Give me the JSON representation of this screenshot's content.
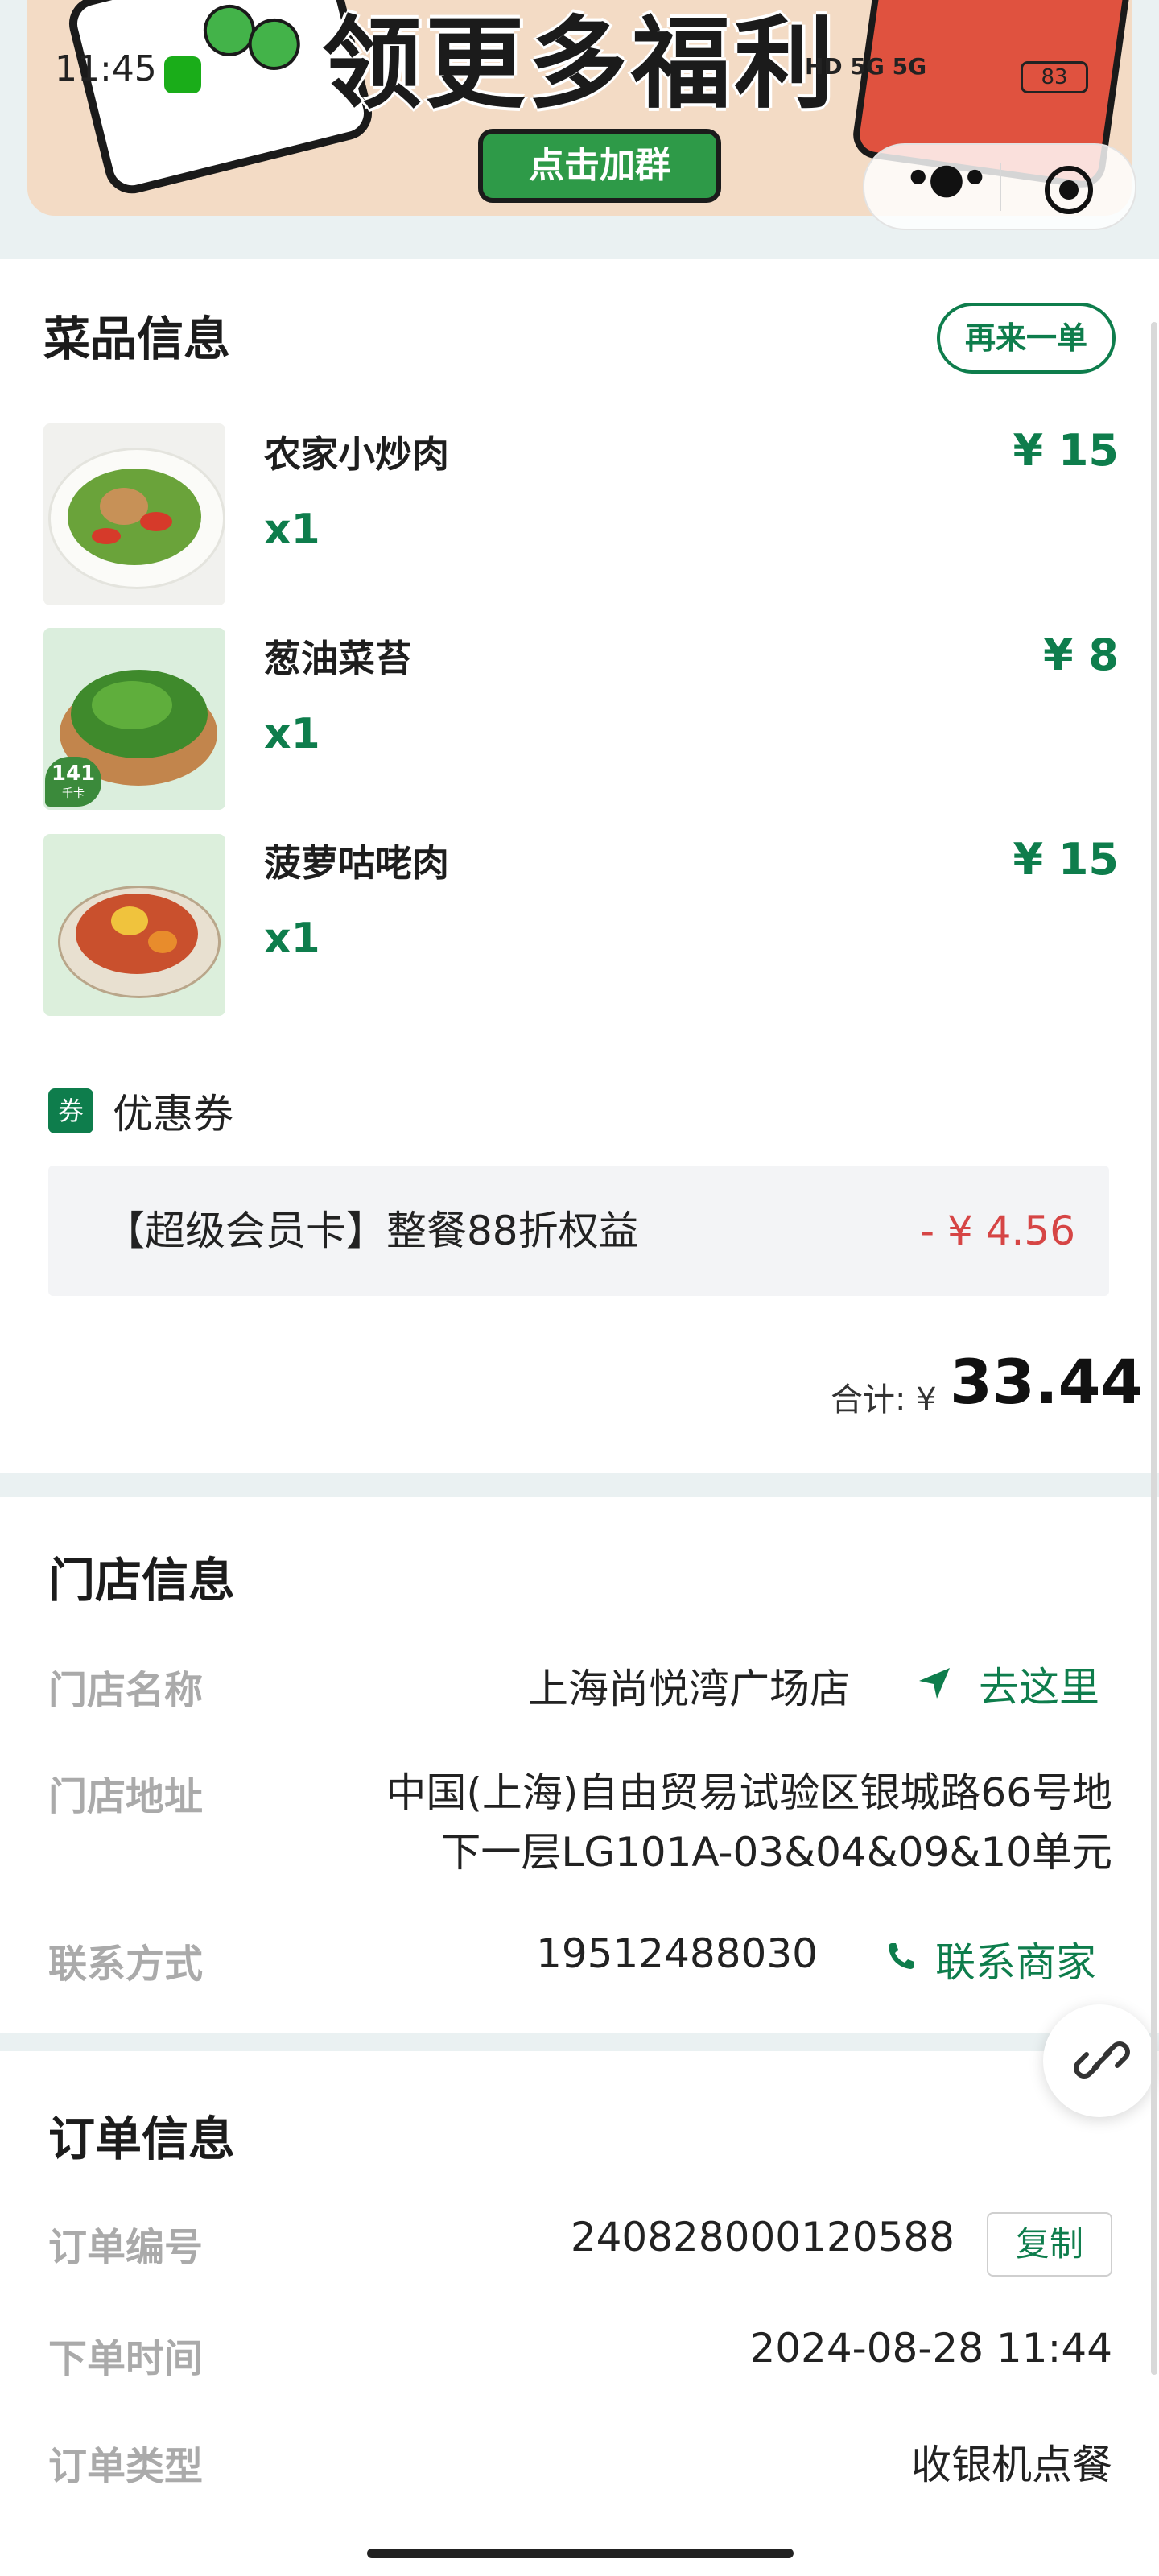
{
  "status_bar": {
    "time": "11:45",
    "network": "HD 5G 5G",
    "battery": "83"
  },
  "banner": {
    "headline": "领更多福利",
    "button": "点击加群"
  },
  "capsule": {
    "more_icon": "more-dots-icon",
    "close_icon": "target-close-icon"
  },
  "dishes_section": {
    "title": "菜品信息",
    "reorder_label": "再来一单",
    "items": [
      {
        "name": "农家小炒肉",
        "qty": "x1",
        "price": "¥ 15"
      },
      {
        "name": "葱油菜苔",
        "qty": "x1",
        "price": "¥ 8",
        "calorie_value": "141",
        "calorie_unit": "千卡"
      },
      {
        "name": "菠萝咕咾肉",
        "qty": "x1",
        "price": "¥ 15"
      }
    ],
    "coupon": {
      "badge": "券",
      "title": "优惠券",
      "name": "【超级会员卡】整餐88折权益",
      "amount": "- ¥ 4.56"
    },
    "total": {
      "label": "合计: ¥",
      "value": "33.44"
    }
  },
  "store_section": {
    "title": "门店信息",
    "name_label": "门店名称",
    "name_value": "上海尚悦湾广场店",
    "navigate_label": "去这里",
    "address_label": "门店地址",
    "address_line1": "中国(上海)自由贸易试验区银城路66号地",
    "address_line2": "下一层LG101A-03&04&09&10单元",
    "contact_label": "联系方式",
    "contact_value": "19512488030",
    "contact_action": "联系商家"
  },
  "order_section": {
    "title": "订单信息",
    "number_label": "订单编号",
    "number_value": "240828000120588",
    "copy_label": "复制",
    "time_label": "下单时间",
    "time_value": "2024-08-28 11:44",
    "type_label": "订单类型",
    "type_value": "收银机点餐"
  },
  "colors": {
    "brand_green": "#0e7d4c",
    "discount_red": "#d64545",
    "page_bg": "#eaf1f2"
  }
}
